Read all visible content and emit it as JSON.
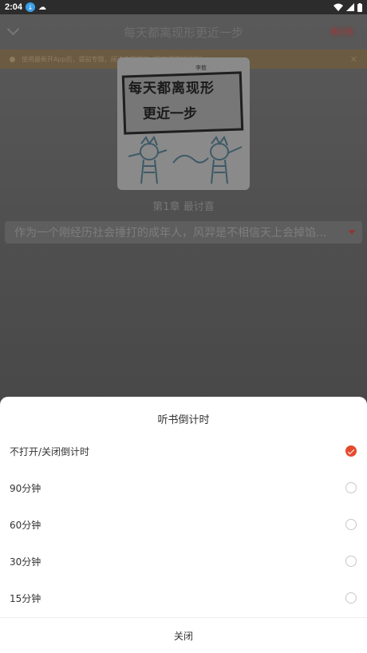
{
  "status_bar": {
    "time": "2:04"
  },
  "app_bar": {
    "title": "每天都离现形更近一步",
    "read_novel_label": "看小说"
  },
  "notice": {
    "text": "使用最新开App后，提前专题，阅读使用即可《现在都赚钱的新》"
  },
  "book": {
    "cover_line1": "每天都离现形",
    "cover_line2": "更近一步",
    "cover_tag": "李敖",
    "chapter": "第1章 最讨喜",
    "excerpt": "作为一个刚经历社会捶打的成年人，风羿是不相信天上会掉馅..."
  },
  "sheet": {
    "title": "听书倒计时",
    "options": [
      {
        "label": "不打开/关闭倒计时",
        "checked": true
      },
      {
        "label": "90分钟",
        "checked": false
      },
      {
        "label": "60分钟",
        "checked": false
      },
      {
        "label": "30分钟",
        "checked": false
      },
      {
        "label": "15分钟",
        "checked": false
      }
    ],
    "close_label": "关闭"
  },
  "colors": {
    "accent": "#e64a2e",
    "scrim": "#4f4f4f"
  },
  "icons": [
    "download-icon",
    "cloud-icon",
    "wifi-icon",
    "signal-icon",
    "battery-icon",
    "chevron-down-icon",
    "close-icon",
    "check-icon"
  ]
}
